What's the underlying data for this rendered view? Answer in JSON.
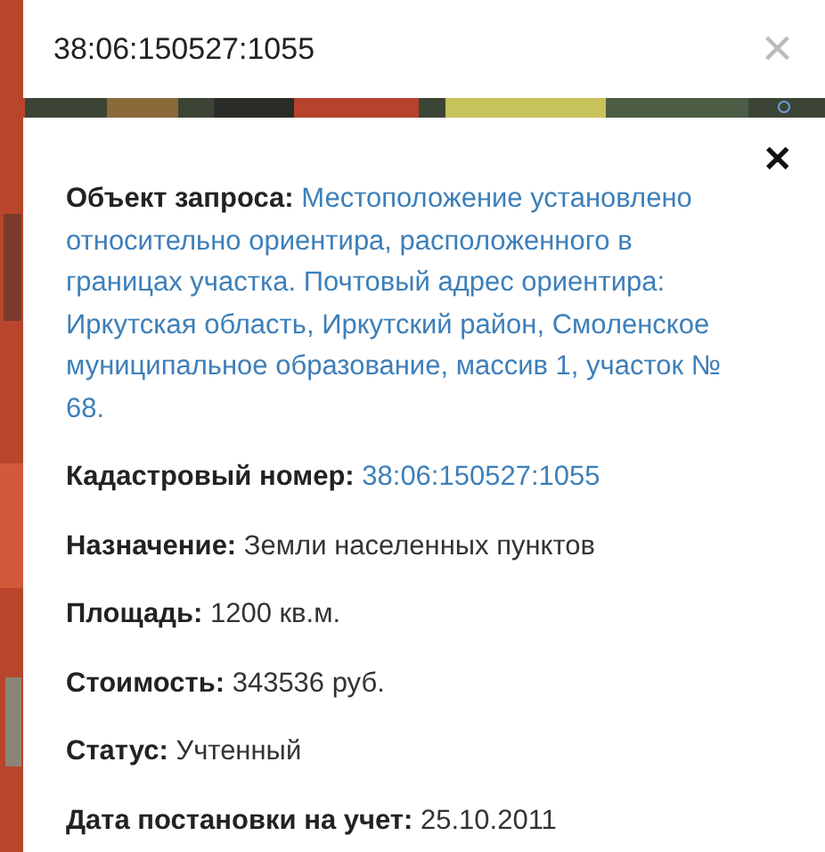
{
  "header": {
    "title": "38:06:150527:1055",
    "close": "×"
  },
  "panel": {
    "close": "✕",
    "fields": [
      {
        "label": "Объект запроса:",
        "value": "Местоположение установлено относительно ориентира, расположенного в границах участка. Почтовый адрес ориентира: Иркутская область, Иркутский район, Смоленское муниципальное образование, массив 1, участок № 68.",
        "kind": "link"
      },
      {
        "label": "Кадастровый номер:",
        "value": "38:06:150527:1055",
        "kind": "link"
      },
      {
        "label": "Назначение:",
        "value": "Земли населенных пунктов",
        "kind": "text"
      },
      {
        "label": "Площадь:",
        "value": "1200 кв.м.",
        "kind": "text"
      },
      {
        "label": "Стоимость:",
        "value": "343536 руб.",
        "kind": "text"
      },
      {
        "label": "Статус:",
        "value": "Учтенный",
        "kind": "text"
      },
      {
        "label": "Дата постановки на учет:",
        "value": "25.10.2011",
        "kind": "text"
      }
    ]
  }
}
